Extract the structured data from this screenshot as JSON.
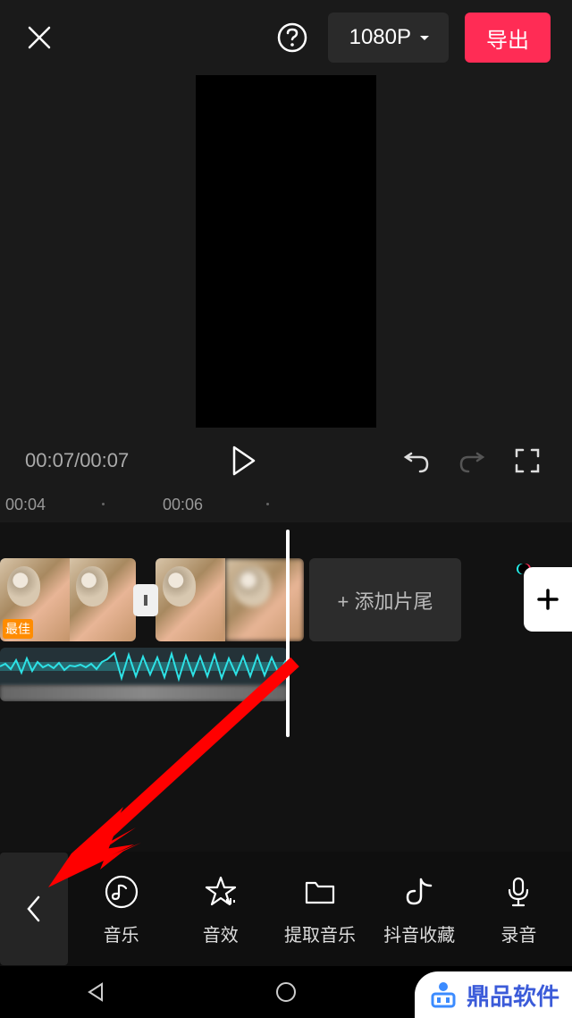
{
  "header": {
    "resolution_label": "1080P",
    "export_label": "导出"
  },
  "playback": {
    "current_time": "00:07",
    "total_time": "00:07"
  },
  "ruler": {
    "labels": [
      "00:04",
      "00:06"
    ]
  },
  "timeline": {
    "add_tail_label": "+  添加片尾",
    "clip1_tag": "最佳"
  },
  "tools": [
    {
      "id": "music",
      "label": "音乐",
      "icon": "music-note-icon"
    },
    {
      "id": "sfx",
      "label": "音效",
      "icon": "star-icon"
    },
    {
      "id": "extract",
      "label": "提取音乐",
      "icon": "folder-icon"
    },
    {
      "id": "douyin",
      "label": "抖音收藏",
      "icon": "douyin-icon"
    },
    {
      "id": "record",
      "label": "录音",
      "icon": "mic-icon"
    }
  ],
  "watermark": {
    "text": "鼎品软件"
  }
}
